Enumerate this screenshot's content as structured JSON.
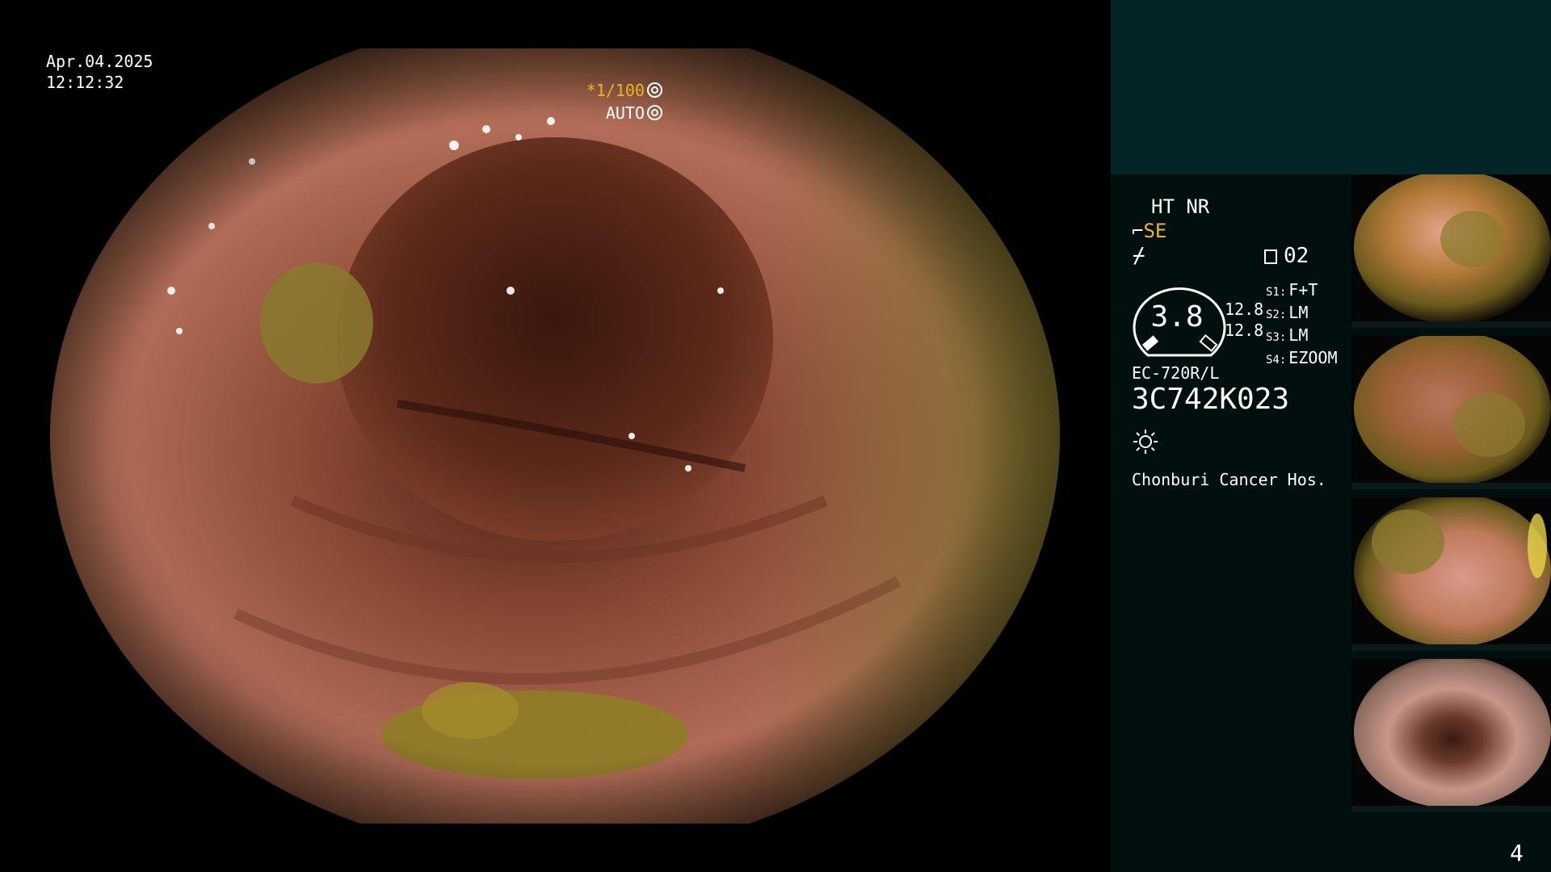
{
  "overlay": {
    "date": "Apr.04.2025",
    "time": "12:12:32",
    "shutter_value": "*1/100",
    "iris_mode": "AUTO"
  },
  "panel": {
    "mode_line_1": "HT NR",
    "mode_line_2_prefix": "⌐",
    "mode_line_2": "SE",
    "mode_line_3": "⌿",
    "page_number": "02",
    "zoom_factor": "3.8",
    "zoom_values": [
      "12.8",
      "12.8"
    ],
    "switches": [
      {
        "key": "S1:",
        "value": "F+T"
      },
      {
        "key": "S2:",
        "value": "LM"
      },
      {
        "key": "S3:",
        "value": "LM"
      },
      {
        "key": "S4:",
        "value": "EZOOM"
      }
    ],
    "scope_model": "EC-720R/L",
    "scope_serial": "3C742K023",
    "hospital": "Chonburi Cancer Hos.",
    "frame_count": "4"
  },
  "colors": {
    "accent": "#f0b41e",
    "panel_bg": "#01100f",
    "panel_top_bg": "#032527"
  }
}
